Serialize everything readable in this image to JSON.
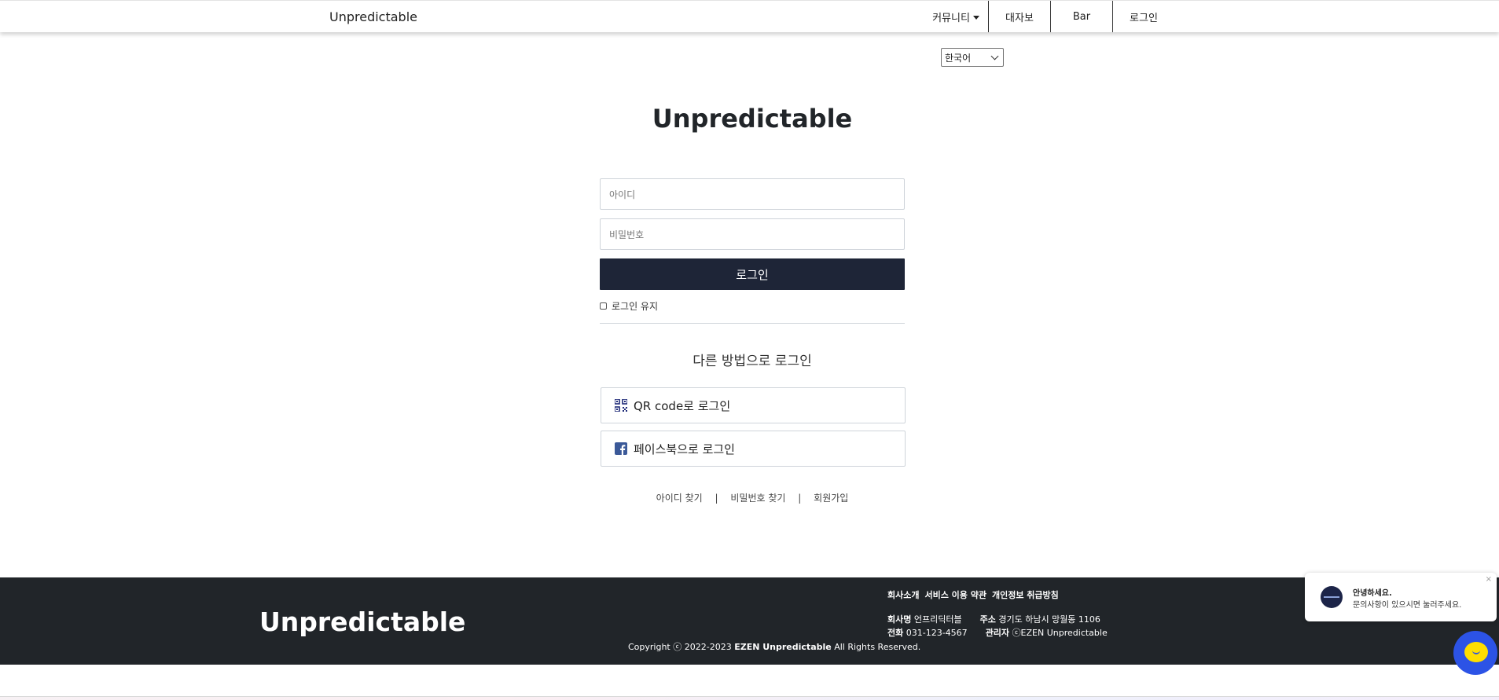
{
  "nav": {
    "brand": "Unpredictable",
    "items": [
      {
        "label": "커뮤니티"
      },
      {
        "label": "대자보"
      },
      {
        "label": "Bar"
      },
      {
        "label": "로그인"
      }
    ]
  },
  "language": {
    "selected": "한국어"
  },
  "login": {
    "title": "Unpredictable",
    "id_placeholder": "아이디",
    "pw_placeholder": "비밀번호",
    "button": "로그인",
    "keep_label": "로그인 유지",
    "other_methods": "다른 방법으로 로그인",
    "qr_label": "QR code로 로그인",
    "facebook_label": "페이스북으로 로그인",
    "links": [
      "아이디 찾기",
      "비밀번호 찾기",
      "회원가입"
    ],
    "separator": "|"
  },
  "footer": {
    "brand": "Unpredictable",
    "links": [
      "회사소개",
      "서비스 이용 약관",
      "개인정보 취급방침"
    ],
    "company_label": "회사명",
    "company_value": "언프리딕터블",
    "address_label": "주소",
    "address_value": "경기도 하남시 망월동 1106",
    "phone_label": "전화",
    "phone_value": "031-123-4567",
    "admin_label": "관리자",
    "admin_value": "ⓒEZEN Unpredictable",
    "copyright_prefix": "Copyright ⓒ 2022-2023 ",
    "copyright_brand": "EZEN Unpredictable",
    "copyright_suffix": " All Rights Reserved."
  },
  "chat": {
    "greeting": "안녕하세요.",
    "message": "문의사항이 있으시면 눌러주세요.",
    "close": "×"
  },
  "colors": {
    "login_button": "#1e2537",
    "footer_bg": "#212529",
    "chat_fab": "#2c53e6",
    "chat_bubble": "#ffde00",
    "facebook": "#3b5998",
    "qr": "#1e2a78"
  }
}
